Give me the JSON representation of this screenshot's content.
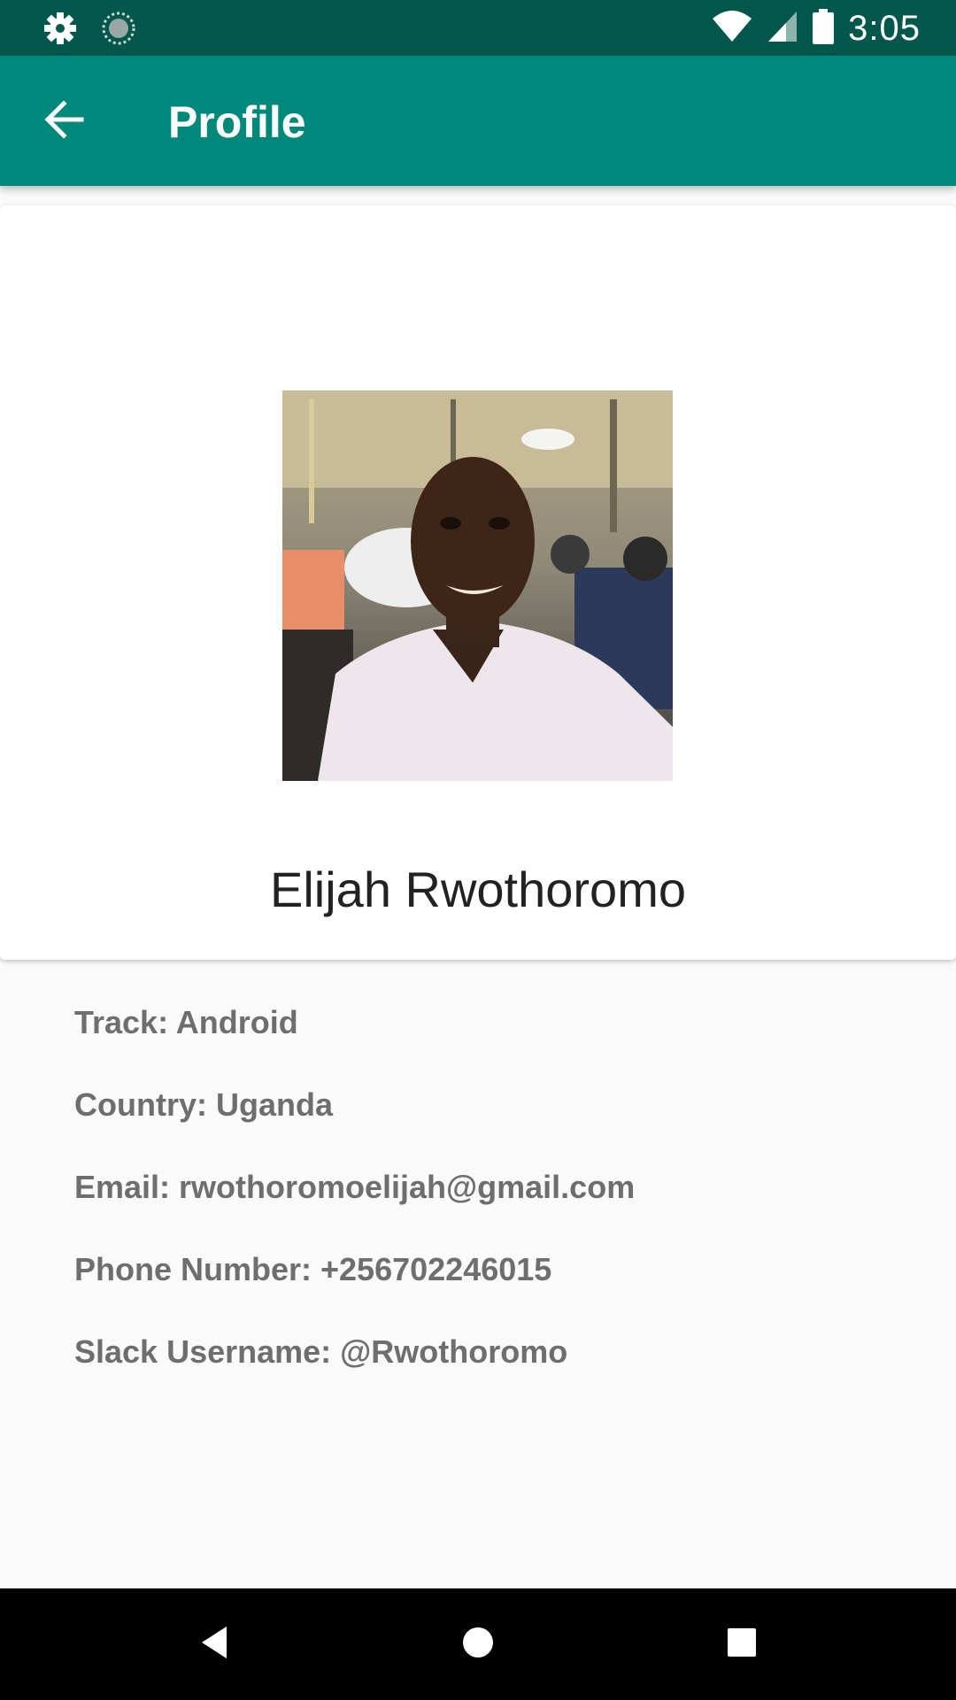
{
  "status_bar": {
    "time": "3:05",
    "icons": [
      "settings-icon",
      "sync-icon",
      "wifi-icon",
      "signal-icon",
      "battery-icon"
    ]
  },
  "app_bar": {
    "title": "Profile",
    "back_icon": "arrow-back-icon",
    "background": "#00897b"
  },
  "profile": {
    "name": "Elijah Rwothoromo",
    "avatar_alt": "profile photo"
  },
  "details": [
    {
      "label": "Track: Android"
    },
    {
      "label": "Country: Uganda"
    },
    {
      "label": "Email: rwothoromoelijah@gmail.com"
    },
    {
      "label": "Phone Number: +256702246015"
    },
    {
      "label": "Slack Username: @Rwothoromo"
    }
  ],
  "nav_bar": {
    "icons": [
      "back-triangle-icon",
      "home-circle-icon",
      "recents-square-icon"
    ]
  },
  "colors": {
    "status_bar": "#01574b",
    "app_bar": "#00897b",
    "detail_text": "#6e6e6e",
    "page_bg": "#fafafa"
  }
}
